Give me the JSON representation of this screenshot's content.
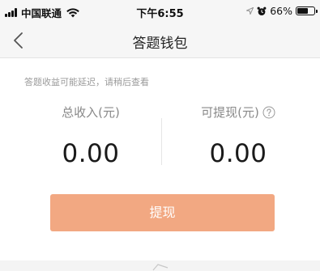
{
  "status_bar": {
    "carrier": "中国联通",
    "time": "下午6:55",
    "battery": "66%",
    "battery_level": 0.66
  },
  "nav": {
    "title": "答题钱包",
    "back_icon": "chevron-left-icon"
  },
  "notice": "答题收益可能延迟，请稍后查看",
  "balance": {
    "total_income_label": "总收入(元)",
    "total_income_value": "0.00",
    "withdrawable_label": "可提现(元)",
    "withdrawable_value": "0.00",
    "help_icon": "question-circle-icon"
  },
  "actions": {
    "withdraw_label": "提现"
  },
  "colors": {
    "accent": "#f2a882",
    "bar_bg": "#f6f6f6",
    "muted_text": "#9a9a9a"
  }
}
